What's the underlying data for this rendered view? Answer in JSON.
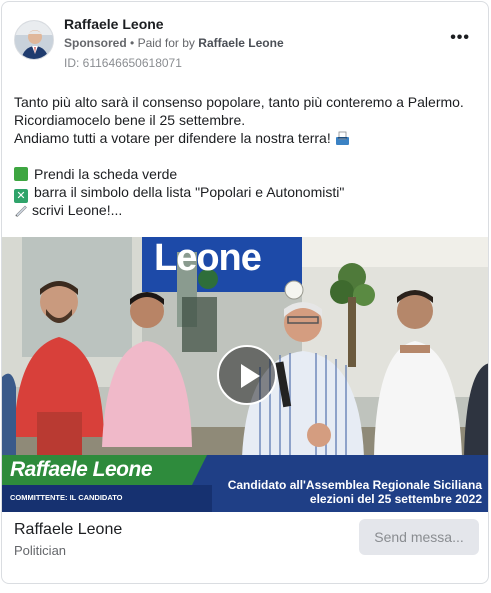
{
  "header": {
    "page_name": "Raffaele Leone",
    "sponsored": "Sponsored",
    "separator": "•",
    "paid_for_by": "Paid for by",
    "payer": "Raffaele Leone",
    "ad_id": "ID: 611646650618071",
    "more_label": "•••"
  },
  "post": {
    "lines": [
      "Tanto più alto sarà il consenso popolare, tanto più conteremo a Palermo.",
      "Ricordiamocelo bene il 25 settembre.",
      "Andiamo tutti a votare per difendere la nostra terra!"
    ],
    "bullets": [
      {
        "icon": "green-book-icon",
        "text": "Prendi la scheda verde"
      },
      {
        "icon": "cross-mark-icon",
        "text": "barra il simbolo della lista \"Popolari e Autonomisti\""
      },
      {
        "icon": "pen-icon",
        "text": "scrivi Leone!..."
      }
    ]
  },
  "video": {
    "sign_text": "Leone",
    "banner_name": "Raffaele Leone",
    "committente": "COMMITTENTE: IL CANDIDATO",
    "candidacy_line1": "Candidato all'Assemblea Regionale Siciliana",
    "candidacy_line2": "elezioni del 25 settembre 2022",
    "play_icon": "play-icon"
  },
  "footer": {
    "name": "Raffaele Leone",
    "category": "Politician",
    "cta_label": "Send messa..."
  },
  "colors": {
    "banner_green": "#2e8b3c",
    "banner_blue": "#1f3f86",
    "cta_bg": "#e4e6eb",
    "meta_gray": "#65676b"
  }
}
